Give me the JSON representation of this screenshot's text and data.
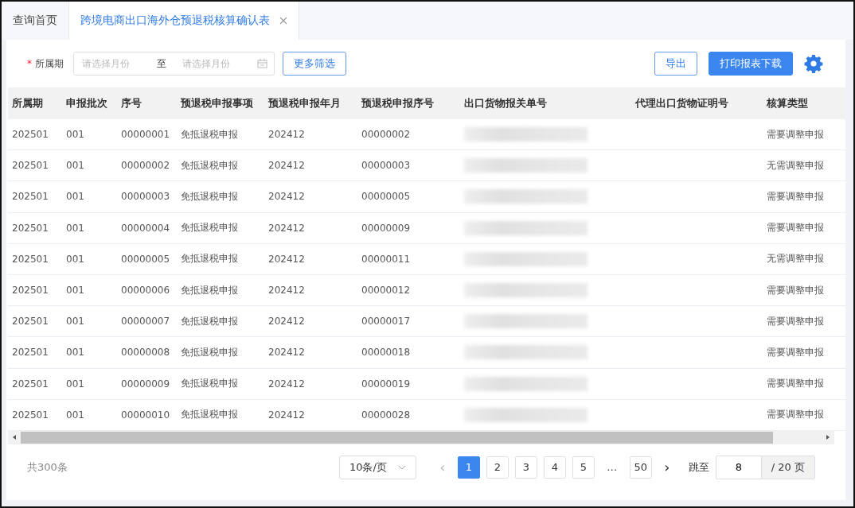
{
  "tabs": [
    {
      "label": "查询首页",
      "selected": false,
      "closable": false
    },
    {
      "label": "跨境电商出口海外仓预退税核算确认表",
      "selected": true,
      "closable": true
    }
  ],
  "filter": {
    "label": "所属期",
    "required_mark": "*",
    "start_placeholder": "请选择月份",
    "separator": "至",
    "end_placeholder": "请选择月份",
    "more_button": "更多筛选"
  },
  "actions": [
    {
      "label": "导出",
      "kind": "outline"
    },
    {
      "label": "打印报表下载",
      "kind": "primary"
    }
  ],
  "table": {
    "columns": [
      "所属期",
      "申报批次",
      "序号",
      "预退税申报事项",
      "预退税申报年月",
      "预退税申报序号",
      "出口货物报关单号",
      "代理出口货物证明号",
      "核算类型"
    ],
    "rows": [
      [
        "202501",
        "001",
        "00000001",
        "免抵退税申报",
        "202412",
        "00000002",
        "",
        "",
        "需要调整申报"
      ],
      [
        "202501",
        "001",
        "00000002",
        "免抵退税申报",
        "202412",
        "00000003",
        "",
        "",
        "无需调整申报"
      ],
      [
        "202501",
        "001",
        "00000003",
        "免抵退税申报",
        "202412",
        "00000005",
        "",
        "",
        "需要调整申报"
      ],
      [
        "202501",
        "001",
        "00000004",
        "免抵退税申报",
        "202412",
        "00000009",
        "",
        "",
        "需要调整申报"
      ],
      [
        "202501",
        "001",
        "00000005",
        "免抵退税申报",
        "202412",
        "00000011",
        "",
        "",
        "无需调整申报"
      ],
      [
        "202501",
        "001",
        "00000006",
        "免抵退税申报",
        "202412",
        "00000012",
        "",
        "",
        "需要调整申报"
      ],
      [
        "202501",
        "001",
        "00000007",
        "免抵退税申报",
        "202412",
        "00000017",
        "",
        "",
        "需要调整申报"
      ],
      [
        "202501",
        "001",
        "00000008",
        "免抵退税申报",
        "202412",
        "00000018",
        "",
        "",
        "需要调整申报"
      ],
      [
        "202501",
        "001",
        "00000009",
        "免抵退税申报",
        "202412",
        "00000019",
        "",
        "",
        "需要调整申报"
      ],
      [
        "202501",
        "001",
        "00000010",
        "免抵退税申报",
        "202412",
        "00000028",
        "",
        "",
        "需要调整申报"
      ]
    ]
  },
  "pagination": {
    "total": "共300条",
    "page_size": "10条/页",
    "prev": "‹",
    "pages": [
      {
        "label": "1",
        "selected": true
      },
      {
        "label": "2",
        "selected": false
      },
      {
        "label": "3",
        "selected": false
      },
      {
        "label": "4",
        "selected": false
      },
      {
        "label": "5",
        "selected": false
      },
      {
        "label": "…",
        "selected": false,
        "kind": "ellipsis"
      },
      {
        "label": "50",
        "selected": false
      }
    ],
    "next": "›",
    "jump_label": "跳至",
    "jump_value": "8",
    "jump_suffix": "/ 20 页"
  }
}
